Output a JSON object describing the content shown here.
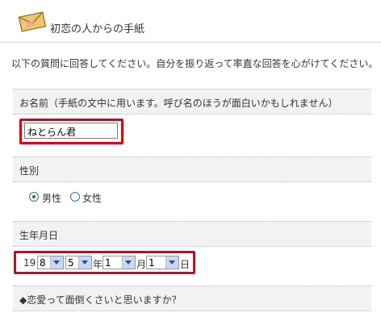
{
  "header": {
    "title": "初恋の人からの手紙"
  },
  "intro": "以下の質問に回答してください。自分を振り返って率直な回答を心がけてください。",
  "name_section": {
    "label": "お名前（手紙の文中に用います。呼び名のほうが面白いかもしれません）",
    "value": "ねとらん君"
  },
  "gender_section": {
    "label": "性別",
    "options": [
      {
        "label": "男性",
        "selected": true
      },
      {
        "label": "女性",
        "selected": false
      }
    ]
  },
  "birth_section": {
    "label": "生年月日",
    "prefix": "19",
    "year_tens": "8",
    "year_ones": "5",
    "year_suffix": "年",
    "month": "1",
    "month_suffix": "月",
    "day": "1",
    "day_suffix": "日"
  },
  "question_section": {
    "label": "◆恋愛って面倒くさいと思いますか？"
  },
  "colors": {
    "highlight": "#d9001b",
    "section_bg": "#f2f2f2"
  },
  "icons": {
    "header": "envelope-icon"
  }
}
